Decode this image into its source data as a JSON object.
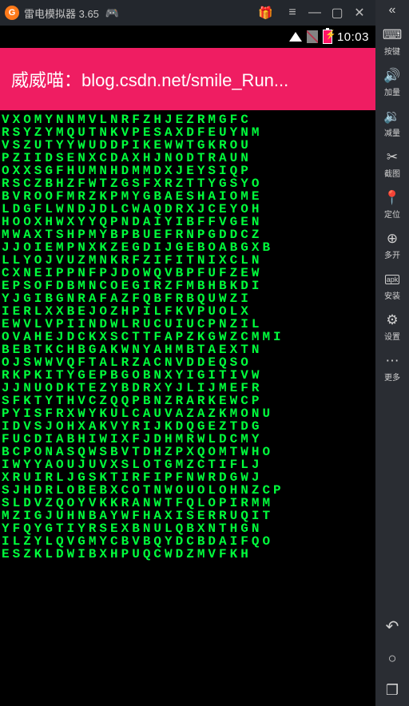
{
  "titlebar": {
    "app_name": "雷电模拟器 3.65",
    "gift_icon": "🎁"
  },
  "status": {
    "time": "10:03"
  },
  "header": {
    "text": "威威喵：blog.csdn.net/smile_Run..."
  },
  "matrix_lines": [
    "VXOMYNNMVLNRFZHJEZRMGFC",
    "RSYZYMQUTNKVPESAXDFEUYNM",
    "VSZUTYYWUDDPIKEWWTGKROU",
    "PZIIDSENXCDAXHJNODTRAUN",
    "OXXSGFHUMNHDMMDXJEYSIQP",
    "RSCZBHZFWTZGSFXRZTTYGSYO",
    "BVROOFMRZKPMYGBAESHAIOME",
    "LDGFLWNDJDLCWAQDRXJCEYOH",
    "HOOXHWXYYQPNDAIYIBFFVGEN",
    "MWAXTSHPMYBPBUEFRNPGDDCZ",
    "JJOIEMPNXKZEGDIJGEBOABGXB",
    "LLYOJVUZMNKRFZIFITNIXCLN",
    "CXNEIPPNFPJDOWQVBPFUFZEW",
    "EPSOFDBMNCOEGIRZFMBHBKDI",
    "YJGIBGNRAFAZFQBFRBQUWZI",
    "IERLXXBEJOZHPILFKVPUOLX",
    "EWVLVPIINDWLRUCUIUCPNZIL",
    "OVAHEJDCKXSCTTFAPZKGWZCMMI",
    "BEBTKCHBGAKWNYAHMBTAEXTN",
    "OJSWWVQFTALRZACNVDDEQSO",
    "RKPKITYGEPBGOBNXYIGITIVW",
    "JJNUODKTEZYBDRXYJLIJMEFR",
    "SFKTYTHVCZQQPBNZRARKEWCP",
    "PYISFRXWYKULCAUVAZAZKMONU",
    "IDVSJOHXAKVYRIJKDQGEZTDG",
    "FUCDIABHIWIXFJDHMRWLDCMY",
    "BCPONASQWSBVTDHZPXQOMTWHO",
    "IWYYAOUJUVXSLOTGMZCTIFLJ",
    "XRUIRLJGSKTIRFIPFNWRDGWJ",
    "SJHDRLOBEBXCOTNWOUOLOHNZCP",
    "SLDVZQOYVKKRANWTFQLOPIRMM",
    "MZIGJUHNBAYWFHAXISERRUQIT",
    "YFQYGTIYRSEXBNULQBXNTHGN",
    "ILZYLQVGMYCBVBQYDCBDAIFQO",
    "ESZKLDWIBXHPUQCWDZMVFKH"
  ],
  "sidebar": {
    "tools": [
      {
        "icon": "kbd",
        "label": "按键"
      },
      {
        "icon": "vol-up",
        "label": "加量"
      },
      {
        "icon": "vol-dn",
        "label": "减量"
      },
      {
        "icon": "cut",
        "label": "截图"
      },
      {
        "icon": "pin",
        "label": "定位"
      },
      {
        "icon": "multi",
        "label": "多开"
      },
      {
        "icon": "apk",
        "label": "安装"
      },
      {
        "icon": "gear",
        "label": "设置"
      },
      {
        "icon": "more",
        "label": "更多"
      }
    ]
  }
}
